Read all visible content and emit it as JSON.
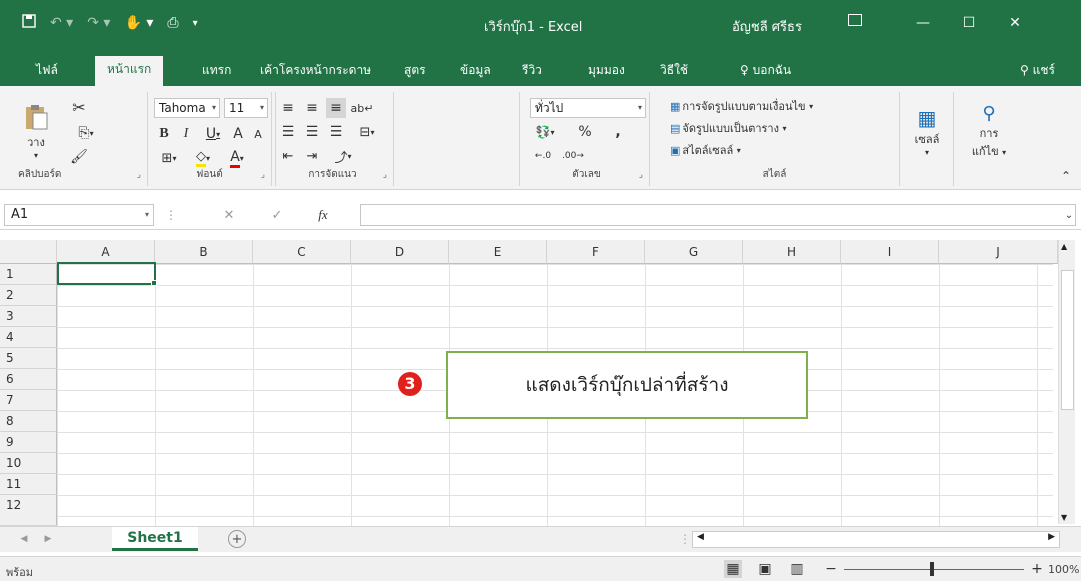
{
  "qat": {
    "save_icon": "save-icon",
    "undo_icon": "undo-icon",
    "redo_icon": "redo-icon",
    "touch_icon": "touch-mode-icon",
    "preview_icon": "print-preview-icon",
    "customize_icon": "customize-qat-icon"
  },
  "window": {
    "title": "เวิร์กบุ๊ก1  -  Excel",
    "user": "อัญชลี ศรีธร"
  },
  "tabs": [
    "ไฟล์",
    "หน้าแรก",
    "แทรก",
    "เค้าโครงหน้ากระดาษ",
    "สูตร",
    "ข้อมูล",
    "รีวิว",
    "มุมมอง",
    "วิธีใช้",
    "บอกฉัน"
  ],
  "share_label": "แชร์",
  "ribbon": {
    "clipboard": {
      "label": "คลิปบอร์ด",
      "paste": "วาง"
    },
    "font": {
      "label": "ฟอนต์",
      "name": "Tahoma",
      "size": "11"
    },
    "alignment": {
      "label": "การจัดแนว"
    },
    "number": {
      "label": "ตัวเลข",
      "format": "ทั่วไป"
    },
    "styles": {
      "label": "สไตล์",
      "conditional": "การจัดรูปแบบตามเงื่อนไข",
      "table": "จัดรูปแบบเป็นตาราง",
      "cell_styles": "สไตล์เซลล์"
    },
    "cells": {
      "label": "เซลล์"
    },
    "editing": {
      "label": "การ",
      "label2": "แก้ไข"
    }
  },
  "formula": {
    "namebox": "A1"
  },
  "columns": [
    "A",
    "B",
    "C",
    "D",
    "E",
    "F",
    "G",
    "H",
    "I",
    "J"
  ],
  "rows": [
    "1",
    "2",
    "3",
    "4",
    "5",
    "6",
    "7",
    "8",
    "9",
    "10",
    "11",
    "12"
  ],
  "sheet": {
    "name": "Sheet1"
  },
  "status": {
    "ready": "พร้อม",
    "zoom": "100%"
  },
  "callout": {
    "badge": "3",
    "text": "แสดงเวิร์กบุ๊กเปล่าที่สร้าง"
  }
}
